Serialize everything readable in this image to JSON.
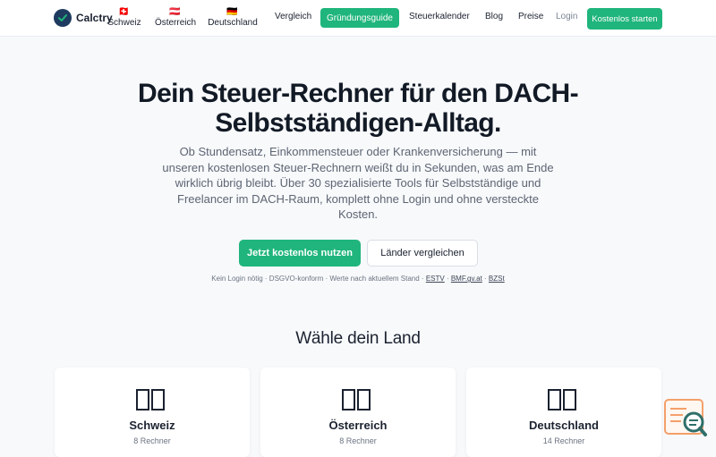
{
  "brand": {
    "name": "Calctry"
  },
  "nav": {
    "countries": [
      {
        "flag": "🇨🇭",
        "label": "Schweiz"
      },
      {
        "flag": "🇦🇹",
        "label": "Österreich"
      },
      {
        "flag": "🇩🇪",
        "label": "Deutschland"
      }
    ],
    "links": [
      "Vergleich",
      "Gründungsguide",
      "Steuerkalender",
      "Blog",
      "Preise"
    ],
    "login": "Login",
    "cta": "Kostenlos starten"
  },
  "hero": {
    "title": "Dein Steuer-Rechner für den DACH-Selbstständigen-Alltag.",
    "subtitle": "Ob Stundensatz, Einkommensteuer oder Krankenversicherung — mit unseren kostenlosen Steuer-Rechnern weißt du in Sekunden, was am Ende wirklich übrig bleibt. Über 30 spezialisierte Tools für Selbstständige und Freelancer im DACH-Raum, komplett ohne Login und ohne versteckte Kosten.",
    "primary_button": "Jetzt kostenlos nutzen",
    "secondary_button": "Länder vergleichen",
    "trust_text": "Kein Login nötig · DSGVO-konform · Werte nach aktuellem Stand · ",
    "sources": [
      "ESTV",
      "BMF.gv.at",
      "BZSt"
    ]
  },
  "countries_section": {
    "title": "Wähle dein Land",
    "cards": [
      {
        "name": "Schweiz",
        "count": "8 Rechner"
      },
      {
        "name": "Österreich",
        "count": "8 Rechner"
      },
      {
        "name": "Deutschland",
        "count": "14 Rechner"
      }
    ]
  },
  "colors": {
    "accent": "#1fb57c",
    "logo_dark": "#1e3a5f",
    "widget_orange": "#f4a06b",
    "widget_teal": "#2f6f6a"
  },
  "icons": {
    "logo": "checkmark-circle-icon",
    "widget": "search-document-icon"
  }
}
